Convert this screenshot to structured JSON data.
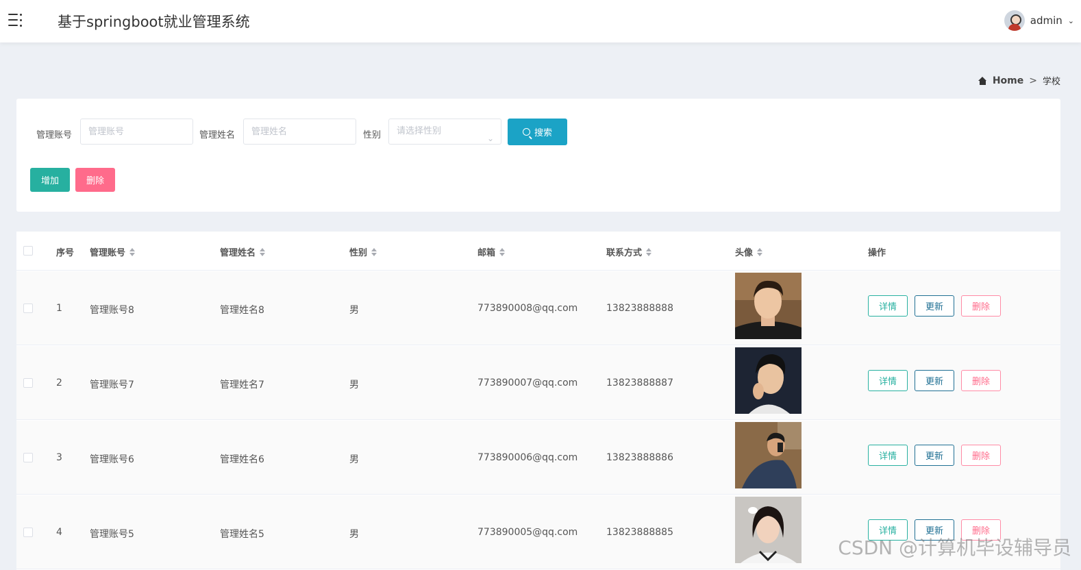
{
  "header": {
    "title": "基于springboot就业管理系统",
    "username": "admin",
    "menu_icon": "menu-icon",
    "avatar_icon": "avatar"
  },
  "breadcrumb": {
    "home": "Home",
    "separator": ">",
    "current": "学校"
  },
  "search": {
    "account_label": "管理账号",
    "account_placeholder": "管理账号",
    "name_label": "管理姓名",
    "name_placeholder": "管理姓名",
    "gender_label": "性别",
    "gender_placeholder": "请选择性别",
    "search_button": "搜索"
  },
  "actions": {
    "add_label": "增加",
    "delete_label": "删除"
  },
  "table": {
    "columns": [
      "序号",
      "管理账号",
      "管理姓名",
      "性别",
      "邮箱",
      "联系方式",
      "头像",
      "操作"
    ],
    "rows": [
      {
        "index": "1",
        "account": "管理账号8",
        "name": "管理姓名8",
        "gender": "男",
        "email": "773890008@qq.com",
        "phone": "13823888888"
      },
      {
        "index": "2",
        "account": "管理账号7",
        "name": "管理姓名7",
        "gender": "男",
        "email": "773890007@qq.com",
        "phone": "13823888887"
      },
      {
        "index": "3",
        "account": "管理账号6",
        "name": "管理姓名6",
        "gender": "男",
        "email": "773890006@qq.com",
        "phone": "13823888886"
      },
      {
        "index": "4",
        "account": "管理账号5",
        "name": "管理姓名5",
        "gender": "男",
        "email": "773890005@qq.com",
        "phone": "13823888885"
      }
    ],
    "row_actions": {
      "detail": "详情",
      "update": "更新",
      "delete": "删除"
    }
  },
  "colors": {
    "search_button": "#1ba3c6",
    "add_button": "#27b0a0",
    "delete_button": "#ff6b8b",
    "update_border": "#1f6f93"
  },
  "watermark": "CSDN @计算机毕设辅导员"
}
